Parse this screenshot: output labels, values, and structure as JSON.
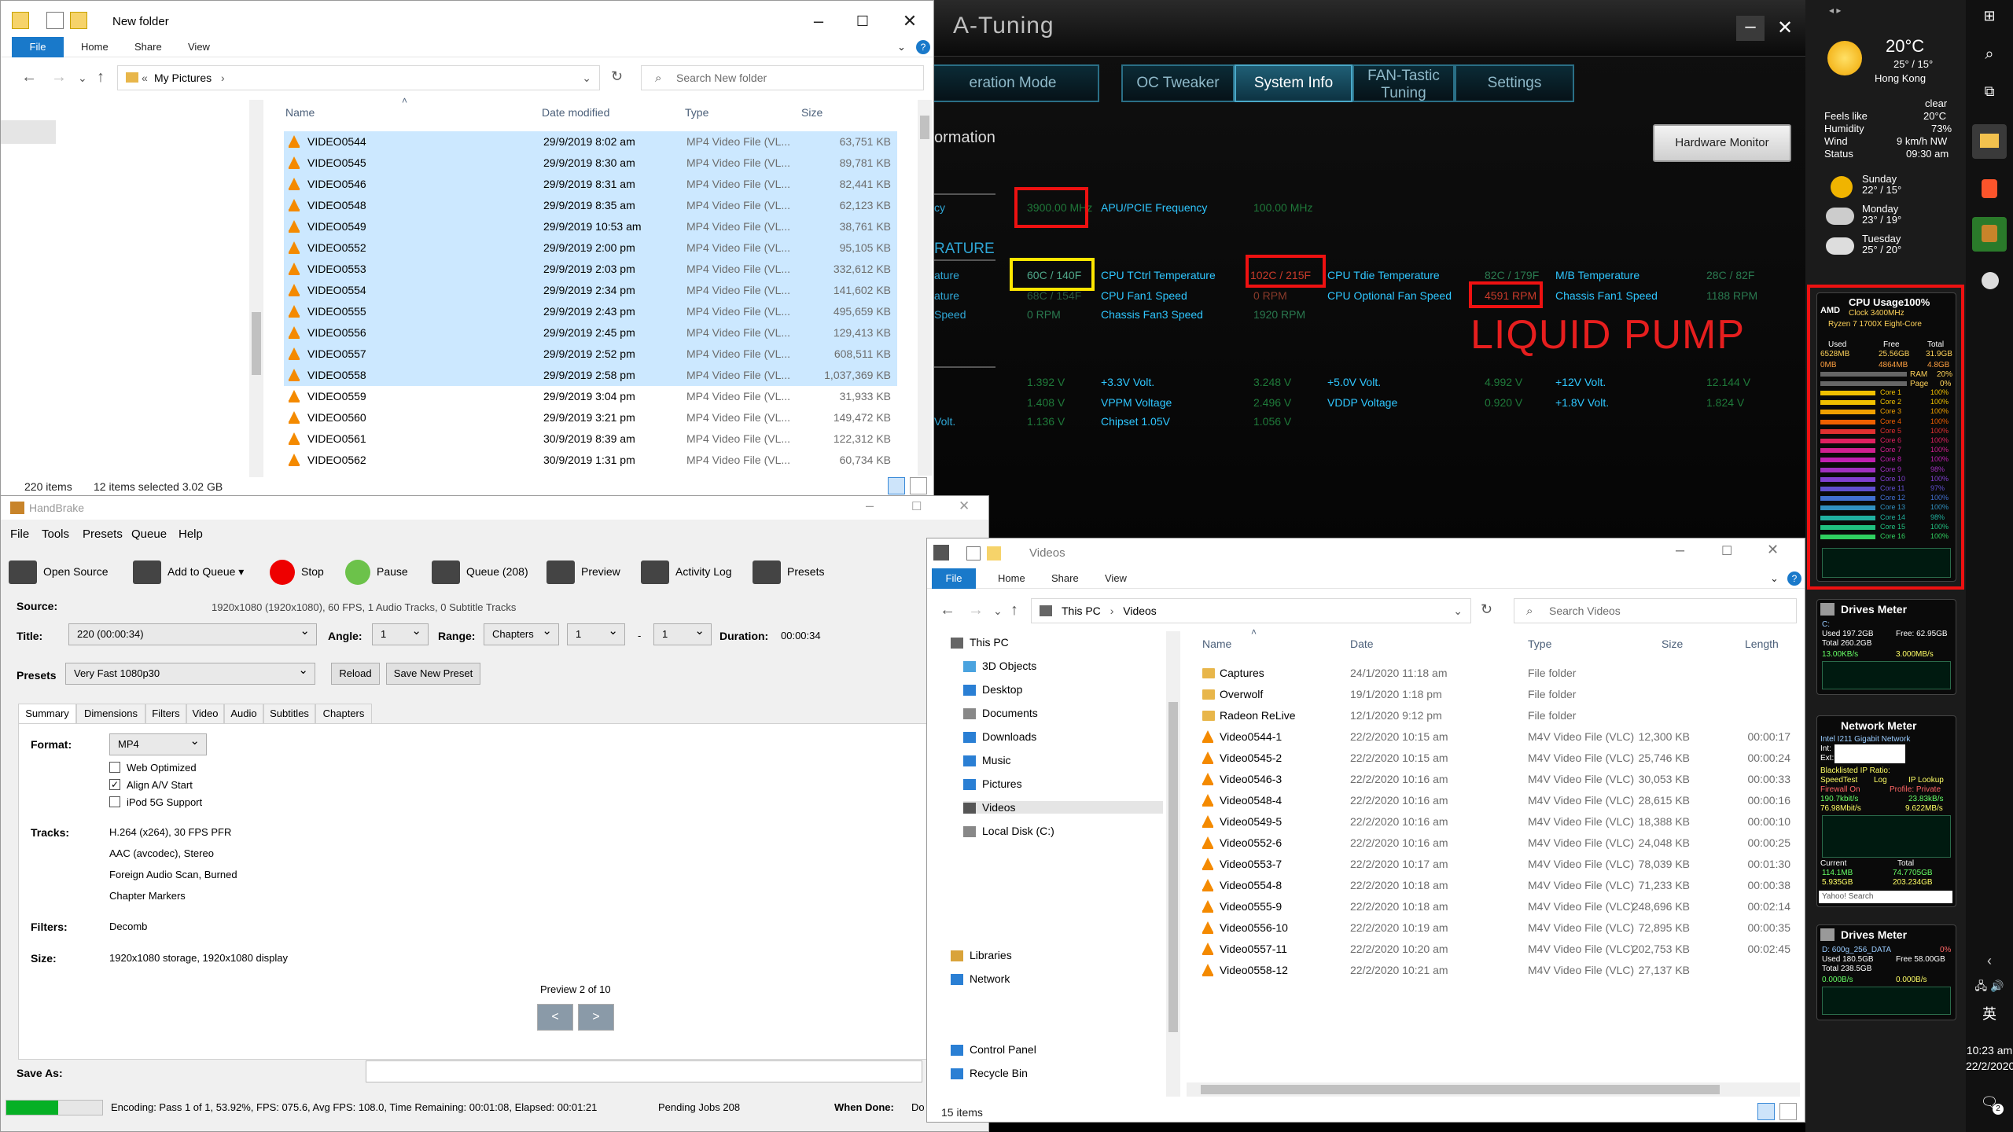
{
  "explorer_top": {
    "title": "New folder",
    "ribbon_tabs": [
      "File",
      "Home",
      "Share",
      "View"
    ],
    "breadcrumb_prefix": "«",
    "breadcrumb": "My Pictures",
    "search_placeholder": "Search New folder",
    "columns": [
      "Name",
      "Date modified",
      "Type",
      "Size"
    ],
    "rows": [
      {
        "name": "VIDEO0544",
        "date": "29/9/2019 8:02 am",
        "type": "MP4 Video File (VL...",
        "size": "63,751 KB",
        "selected": true
      },
      {
        "name": "VIDEO0545",
        "date": "29/9/2019 8:30 am",
        "type": "MP4 Video File (VL...",
        "size": "89,781 KB",
        "selected": true
      },
      {
        "name": "VIDEO0546",
        "date": "29/9/2019 8:31 am",
        "type": "MP4 Video File (VL...",
        "size": "82,441 KB",
        "selected": true
      },
      {
        "name": "VIDEO0548",
        "date": "29/9/2019 8:35 am",
        "type": "MP4 Video File (VL...",
        "size": "62,123 KB",
        "selected": true
      },
      {
        "name": "VIDEO0549",
        "date": "29/9/2019 10:53 am",
        "type": "MP4 Video File (VL...",
        "size": "38,761 KB",
        "selected": true
      },
      {
        "name": "VIDEO0552",
        "date": "29/9/2019 2:00 pm",
        "type": "MP4 Video File (VL...",
        "size": "95,105 KB",
        "selected": true
      },
      {
        "name": "VIDEO0553",
        "date": "29/9/2019 2:03 pm",
        "type": "MP4 Video File (VL...",
        "size": "332,612 KB",
        "selected": true
      },
      {
        "name": "VIDEO0554",
        "date": "29/9/2019 2:34 pm",
        "type": "MP4 Video File (VL...",
        "size": "141,602 KB",
        "selected": true
      },
      {
        "name": "VIDEO0555",
        "date": "29/9/2019 2:43 pm",
        "type": "MP4 Video File (VL...",
        "size": "495,659 KB",
        "selected": true
      },
      {
        "name": "VIDEO0556",
        "date": "29/9/2019 2:45 pm",
        "type": "MP4 Video File (VL...",
        "size": "129,413 KB",
        "selected": true
      },
      {
        "name": "VIDEO0557",
        "date": "29/9/2019 2:52 pm",
        "type": "MP4 Video File (VL...",
        "size": "608,511 KB",
        "selected": true
      },
      {
        "name": "VIDEO0558",
        "date": "29/9/2019 2:58 pm",
        "type": "MP4 Video File (VL...",
        "size": "1,037,369 KB",
        "selected": true
      },
      {
        "name": "VIDEO0559",
        "date": "29/9/2019 3:04 pm",
        "type": "MP4 Video File (VL...",
        "size": "31,933 KB",
        "selected": false
      },
      {
        "name": "VIDEO0560",
        "date": "29/9/2019 3:21 pm",
        "type": "MP4 Video File (VL...",
        "size": "149,472 KB",
        "selected": false
      },
      {
        "name": "VIDEO0561",
        "date": "30/9/2019 8:39 am",
        "type": "MP4 Video File (VL...",
        "size": "122,312 KB",
        "selected": false
      },
      {
        "name": "VIDEO0562",
        "date": "30/9/2019 1:31 pm",
        "type": "MP4 Video File (VL...",
        "size": "60,734 KB",
        "selected": false
      }
    ],
    "status_items": "220 items",
    "status_selected": "12 items selected  3.02 GB"
  },
  "atuning": {
    "title": "A-Tuning",
    "tabs": [
      "eration Mode",
      "OC Tweaker",
      "System Info",
      "FAN-Tastic Tuning",
      "Settings"
    ],
    "active_tab": "System Info",
    "section_title": "ormation",
    "hw_monitor_label": "Hardware Monitor",
    "section_temp": "RATURE",
    "left_fragments": [
      "cy",
      "ature",
      "ature",
      "Speed",
      "Volt."
    ],
    "freq_value": "3900.00 MHz",
    "apu_label": "APU/PCIE Frequency",
    "apu_value": "100.00 MHz",
    "cpu_temp_value": "60C / 140F",
    "cpu_tctrl_label": "CPU TCtrl Temperature",
    "tctrl_value": "102C / 215F",
    "cpu_tdie_label": "CPU Tdie Temperature",
    "tdie_value": "82C / 179F",
    "mb_temp_label": "M/B Temperature",
    "mb_temp_value": "28C / 82F",
    "row2_value_a": "68C / 154F",
    "cpu_fan1_label": "CPU Fan1 Speed",
    "cpu_fan1_value": "0 RPM",
    "cpu_opt_label": "CPU Optional Fan Speed",
    "cpu_opt_value": "4591 RPM",
    "chassis_fan1_label": "Chassis Fan1 Speed",
    "chassis_fan1_value": "1188 RPM",
    "row3_value_a": "0 RPM",
    "chassis_fan3_label": "Chassis Fan3 Speed",
    "chassis_fan3_value": "1920 RPM",
    "liquid_pump": "LIQUID PUMP",
    "volt_v1": "1.392 V",
    "v33_label": "+3.3V Volt.",
    "v33_value": "3.248 V",
    "v50_label": "+5.0V Volt.",
    "v50_value": "4.992 V",
    "v12_label": "+12V Volt.",
    "v12_value": "12.144 V",
    "volt_v2": "1.408 V",
    "vppm_label": "VPPM Voltage",
    "vppm_value": "2.496 V",
    "vddp_label": "VDDP Voltage",
    "vddp_value": "0.920 V",
    "v18_label": "+1.8V Volt.",
    "v18_value": "1.824 V",
    "volt_v3": "1.136 V",
    "chipset_label": "Chipset 1.05V",
    "chipset_value": "1.056 V"
  },
  "handbrake": {
    "title": "HandBrake",
    "menu": [
      "File",
      "Tools",
      "Presets",
      "Queue",
      "Help"
    ],
    "toolbar": [
      "Open Source",
      "Add to Queue",
      "Stop",
      "Pause",
      "Queue (208)",
      "Preview",
      "Activity Log",
      "Presets"
    ],
    "source_label": "Source:",
    "source_value": "1920x1080 (1920x1080), 60 FPS, 1 Audio Tracks, 0 Subtitle Tracks",
    "title_label": "Title:",
    "title_value": "220 (00:00:34)",
    "angle_label": "Angle:",
    "angle_value": "1",
    "range_label": "Range:",
    "range_value": "Chapters",
    "range_from": "1",
    "range_dash": "-",
    "range_to": "1",
    "duration_label": "Duration:",
    "duration_value": "00:00:34",
    "presets_label": "Presets",
    "preset_value": "Very Fast 1080p30",
    "reload": "Reload",
    "save_new_preset": "Save New Preset",
    "tabs": [
      "Summary",
      "Dimensions",
      "Filters",
      "Video",
      "Audio",
      "Subtitles",
      "Chapters"
    ],
    "format_label": "Format:",
    "format_value": "MP4",
    "web_optimized": "Web Optimized",
    "align_av": "Align A/V Start",
    "ipod": "iPod 5G Support",
    "tracks_label": "Tracks:",
    "tracks": [
      "H.264 (x264), 30 FPS PFR",
      "AAC (avcodec), Stereo",
      "Foreign Audio Scan, Burned",
      "Chapter Markers"
    ],
    "filters_label": "Filters:",
    "filters_value": "Decomb",
    "size_label": "Size:",
    "size_value": "1920x1080 storage, 1920x1080 display",
    "preview_label": "Preview 2 of 10",
    "prev": "<",
    "next": ">",
    "save_as_label": "Save As:",
    "progress": 0.5392,
    "status": "Encoding: Pass 1 of 1,  53.92%, FPS: 075.6,  Avg FPS: 108.0,  Time Remaining: 00:01:08,  Elapsed: 00:01:21",
    "pending": "Pending Jobs 208",
    "when_done": "When Done:",
    "when_done_value": "Do"
  },
  "explorer_videos": {
    "title": "Videos",
    "ribbon_tabs": [
      "File",
      "Home",
      "Share",
      "View"
    ],
    "breadcrumb": [
      "This PC",
      "Videos"
    ],
    "search_placeholder": "Search Videos",
    "sidebar": [
      "This PC",
      "3D Objects",
      "Desktop",
      "Documents",
      "Downloads",
      "Music",
      "Pictures",
      "Videos",
      "Local Disk (C:)",
      "Libraries",
      "Network",
      "Control Panel",
      "Recycle Bin"
    ],
    "columns": [
      "Name",
      "Date",
      "Type",
      "Size",
      "Length"
    ],
    "rows": [
      {
        "name": "Captures",
        "date": "24/1/2020 11:18 am",
        "type": "File folder",
        "size": "",
        "length": "",
        "folder": true
      },
      {
        "name": "Overwolf",
        "date": "19/1/2020 1:18 pm",
        "type": "File folder",
        "size": "",
        "length": "",
        "folder": true
      },
      {
        "name": "Radeon ReLive",
        "date": "12/1/2020 9:12 pm",
        "type": "File folder",
        "size": "",
        "length": "",
        "folder": true
      },
      {
        "name": "Video0544-1",
        "date": "22/2/2020 10:15 am",
        "type": "M4V Video File (VLC)",
        "size": "12,300 KB",
        "length": "00:00:17",
        "folder": false
      },
      {
        "name": "Video0545-2",
        "date": "22/2/2020 10:15 am",
        "type": "M4V Video File (VLC)",
        "size": "25,746 KB",
        "length": "00:00:24",
        "folder": false
      },
      {
        "name": "Video0546-3",
        "date": "22/2/2020 10:16 am",
        "type": "M4V Video File (VLC)",
        "size": "30,053 KB",
        "length": "00:00:33",
        "folder": false
      },
      {
        "name": "Video0548-4",
        "date": "22/2/2020 10:16 am",
        "type": "M4V Video File (VLC)",
        "size": "28,615 KB",
        "length": "00:00:16",
        "folder": false
      },
      {
        "name": "Video0549-5",
        "date": "22/2/2020 10:16 am",
        "type": "M4V Video File (VLC)",
        "size": "18,388 KB",
        "length": "00:00:10",
        "folder": false
      },
      {
        "name": "Video0552-6",
        "date": "22/2/2020 10:16 am",
        "type": "M4V Video File (VLC)",
        "size": "24,048 KB",
        "length": "00:00:25",
        "folder": false
      },
      {
        "name": "Video0553-7",
        "date": "22/2/2020 10:17 am",
        "type": "M4V Video File (VLC)",
        "size": "78,039 KB",
        "length": "00:01:30",
        "folder": false
      },
      {
        "name": "Video0554-8",
        "date": "22/2/2020 10:18 am",
        "type": "M4V Video File (VLC)",
        "size": "71,233 KB",
        "length": "00:00:38",
        "folder": false
      },
      {
        "name": "Video0555-9",
        "date": "22/2/2020 10:18 am",
        "type": "M4V Video File (VLC)",
        "size": "248,696 KB",
        "length": "00:02:14",
        "folder": false
      },
      {
        "name": "Video0556-10",
        "date": "22/2/2020 10:19 am",
        "type": "M4V Video File (VLC)",
        "size": "72,895 KB",
        "length": "00:00:35",
        "folder": false
      },
      {
        "name": "Video0557-11",
        "date": "22/2/2020 10:20 am",
        "type": "M4V Video File (VLC)",
        "size": "202,753 KB",
        "length": "00:02:45",
        "folder": false
      },
      {
        "name": "Video0558-12",
        "date": "22/2/2020 10:21 am",
        "type": "M4V Video File (VLC)",
        "size": "27,137 KB",
        "length": "",
        "folder": false
      }
    ],
    "status_items": "15 items"
  },
  "weather": {
    "temp": "20°C",
    "range": "25° / 15°",
    "city": "Hong Kong",
    "condition": "clear",
    "feels_like_label": "Feels like",
    "feels_like": "20°C",
    "humidity_label": "Humidity",
    "humidity": "73%",
    "wind_label": "Wind",
    "wind": "9 km/h NW",
    "status_label": "Status",
    "status": "09:30 am",
    "forecast": [
      {
        "day": "Sunday",
        "range": "22° / 15°"
      },
      {
        "day": "Monday",
        "range": "23° / 19°"
      },
      {
        "day": "Tuesday",
        "range": "25° / 20°"
      }
    ]
  },
  "cpu_gadget": {
    "title": "CPU Usage100%",
    "clock": "Clock 3400MHz",
    "cpu_name": "Ryzen 7 1700X Eight-Core",
    "mem_headers": [
      "Used",
      "Free",
      "Total"
    ],
    "mem_values": [
      "6528MB",
      "25.56GB",
      "31.9GB"
    ],
    "mem_row2": [
      "0MB",
      "4864MB",
      "4.8GB"
    ],
    "ram_label": "RAM",
    "ram_value": "20%",
    "page_label": "Page",
    "page_value": "0%",
    "cores": [
      {
        "label": "Core 1",
        "value": "100%",
        "color": "#f0c000"
      },
      {
        "label": "Core 2",
        "value": "100%",
        "color": "#f0c000"
      },
      {
        "label": "Core 3",
        "value": "100%",
        "color": "#f0a000"
      },
      {
        "label": "Core 4",
        "value": "100%",
        "color": "#f06000"
      },
      {
        "label": "Core 5",
        "value": "100%",
        "color": "#e03030"
      },
      {
        "label": "Core 6",
        "value": "100%",
        "color": "#e02060"
      },
      {
        "label": "Core 7",
        "value": "100%",
        "color": "#d02090"
      },
      {
        "label": "Core 8",
        "value": "100%",
        "color": "#c020b0"
      },
      {
        "label": "Core 9",
        "value": "98%",
        "color": "#a030c0"
      },
      {
        "label": "Core 10",
        "value": "100%",
        "color": "#8040d0"
      },
      {
        "label": "Core 11",
        "value": "97%",
        "color": "#6050d0"
      },
      {
        "label": "Core 12",
        "value": "100%",
        "color": "#4070d0"
      },
      {
        "label": "Core 13",
        "value": "100%",
        "color": "#3090c0"
      },
      {
        "label": "Core 14",
        "value": "98%",
        "color": "#20b0a0"
      },
      {
        "label": "Core 15",
        "value": "100%",
        "color": "#20c080"
      },
      {
        "label": "Core 16",
        "value": "100%",
        "color": "#30d060"
      }
    ]
  },
  "drives1": {
    "title": "Drives Meter",
    "drive": "C:",
    "used": "Used 197.2GB",
    "free": "Free: 62.95GB",
    "total": "Total 260.2GB",
    "read": "13.00KB/s",
    "write": "3.000MB/s"
  },
  "network": {
    "title": "Network Meter",
    "adapter": "Intel I211 Gigabit Network",
    "int_label": "Int:",
    "ext_label": "Ext:",
    "blacklisted": "Blacklisted IP Ratio:",
    "speed_test": "SpeedTest",
    "log": "Log",
    "ip_lookup": "IP Lookup",
    "firewall": "Firewall On",
    "profile": "Profile: Private",
    "up1": "190.7kbit/s",
    "up2": "23.83kB/s",
    "down1": "76.98Mbit/s",
    "down2": "9.622MB/s",
    "current_label": "Current",
    "total_label": "Total",
    "cur_up": "114.1MB",
    "tot_up": "74.7705GB",
    "cur_down": "5.935GB",
    "tot_down": "203.234GB",
    "search_placeholder": "Yahoo! Search"
  },
  "drives2": {
    "title": "Drives Meter",
    "drive": "D: 600g_256_DATA",
    "pct": "0%",
    "used": "Used 180.5GB",
    "free": "Free 58.00GB",
    "total": "Total 238.5GB",
    "read": "0.000B/s",
    "write": "0.000B/s"
  },
  "taskbar": {
    "time": "10:23 am",
    "date": "22/2/2020",
    "ime": "英",
    "notif_count": "2"
  }
}
